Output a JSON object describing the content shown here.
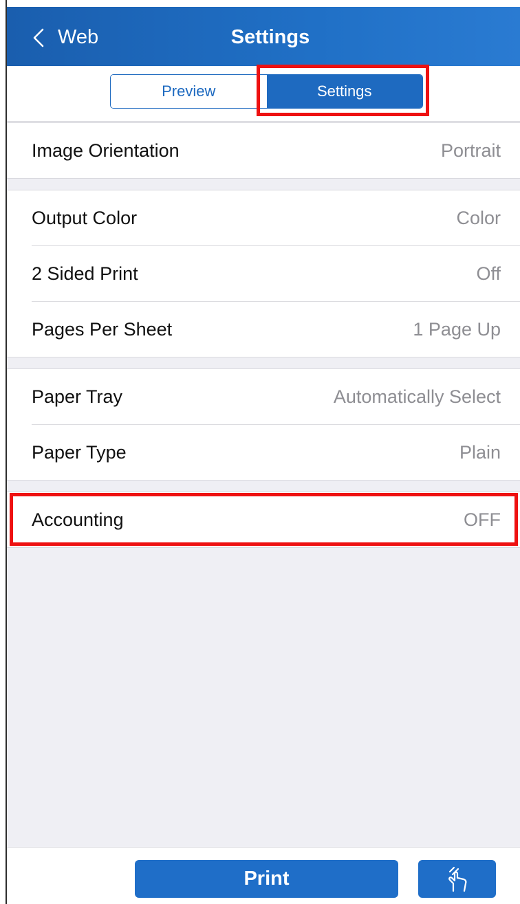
{
  "navbar": {
    "back_label": "Web",
    "title": "Settings"
  },
  "segment": {
    "tabs": [
      {
        "label": "Preview",
        "selected": false
      },
      {
        "label": "Settings",
        "selected": true
      }
    ]
  },
  "groups": [
    {
      "rows": [
        {
          "label": "Image Orientation",
          "value": "Portrait"
        }
      ]
    },
    {
      "rows": [
        {
          "label": "Output Color",
          "value": "Color"
        },
        {
          "label": "2 Sided Print",
          "value": "Off"
        },
        {
          "label": "Pages Per Sheet",
          "value": "1 Page Up"
        }
      ]
    },
    {
      "rows": [
        {
          "label": "Paper Tray",
          "value": "Automatically Select"
        },
        {
          "label": "Paper Type",
          "value": "Plain"
        }
      ]
    },
    {
      "rows": [
        {
          "label": "Accounting",
          "value": "OFF"
        }
      ]
    }
  ],
  "bottom": {
    "print_label": "Print",
    "nfc_icon": "hand-touch-icon"
  },
  "colors": {
    "accent": "#1f6ec8",
    "highlight": "#ee1111"
  }
}
